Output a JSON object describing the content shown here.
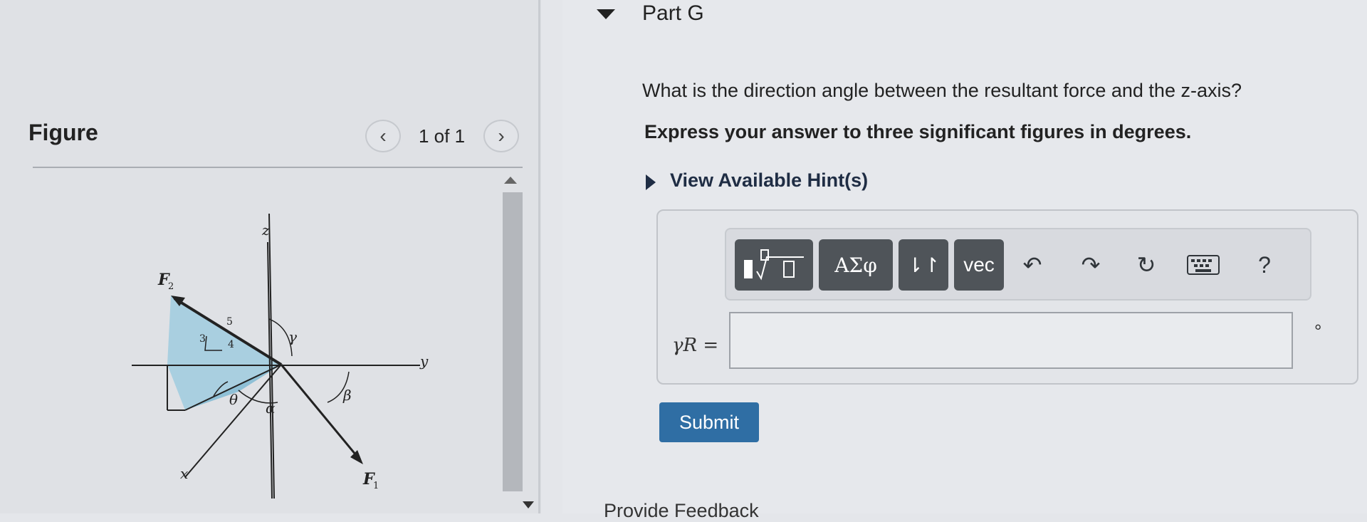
{
  "figure": {
    "title": "Figure",
    "pager": "1 of 1",
    "labels": {
      "f2": "F",
      "f2_sub": "2",
      "f1": "F",
      "f1_sub": "1",
      "z": "z",
      "y": "y",
      "x": "x",
      "gamma": "γ",
      "beta": "β",
      "alpha": "α",
      "theta": "θ",
      "tri_3": "3",
      "tri_4": "4",
      "tri_5": "5"
    }
  },
  "part": {
    "title": "Part G",
    "question": "What is the direction angle between the resultant force and the z-axis?",
    "instruction": "Express your answer to three significant figures in degrees.",
    "hint": "View Available Hint(s)"
  },
  "toolbar": {
    "greek": "ΑΣφ",
    "arrows": "⇂↾",
    "vec": "vec",
    "help": "?"
  },
  "answer": {
    "label": "γR =",
    "unit": "°",
    "value": ""
  },
  "submit_label": "Submit",
  "feedback_label": "Provide Feedback"
}
